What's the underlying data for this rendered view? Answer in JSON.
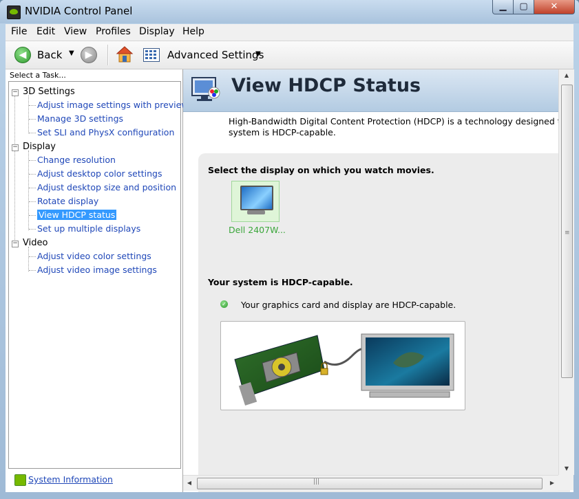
{
  "window": {
    "title": "NVIDIA Control Panel",
    "min_icon": "minimize-icon",
    "max_icon": "maximize-icon",
    "close_glyph": "✕"
  },
  "menu": [
    "File",
    "Edit",
    "View",
    "Profiles",
    "Display",
    "Help"
  ],
  "toolbar": {
    "back": "Back",
    "advanced": "Advanced Settings"
  },
  "sidebar": {
    "header": "Select a Task...",
    "categories": [
      {
        "label": "3D Settings",
        "items": [
          "Adjust image settings with preview",
          "Manage 3D settings",
          "Set SLI and PhysX configuration"
        ]
      },
      {
        "label": "Display",
        "items": [
          "Change resolution",
          "Adjust desktop color settings",
          "Adjust desktop size and position",
          "Rotate display",
          "View HDCP status",
          "Set up multiple displays"
        ]
      },
      {
        "label": "Video",
        "items": [
          "Adjust video color settings",
          "Adjust video image settings"
        ]
      }
    ],
    "selected": "View HDCP status",
    "footer": "System Information"
  },
  "main": {
    "title": "View HDCP Status",
    "description_line1": "High-Bandwidth Digital Content Protection (HDCP) is a technology designed to pr",
    "description_line2": "system is HDCP-capable.",
    "select_prompt": "Select the display on which you watch movies.",
    "display_name": "Dell 2407W...",
    "status_heading": "Your system is HDCP-capable.",
    "status_detail": "Your graphics card and display are HDCP-capable."
  },
  "colors": {
    "link": "#1f47b8",
    "selected_bg": "#3399ff",
    "nvidia_green": "#76b900",
    "display_label": "#3aa63a"
  }
}
